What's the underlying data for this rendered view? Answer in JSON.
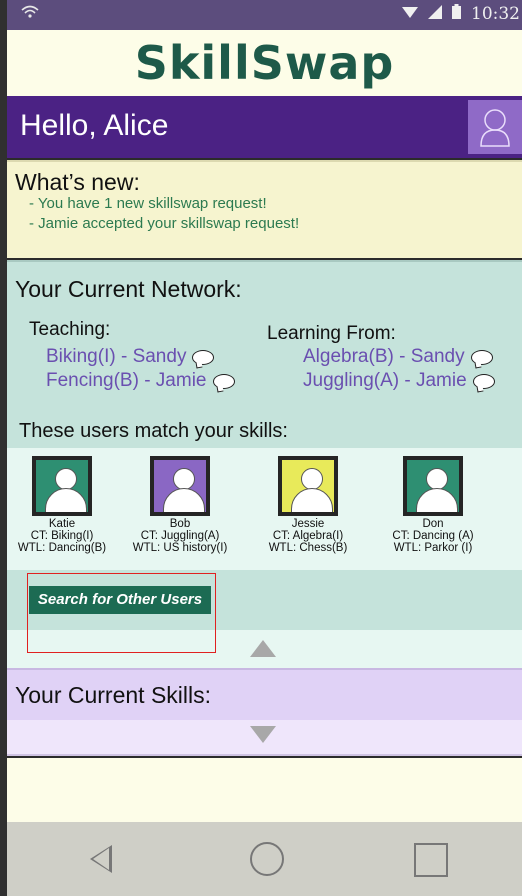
{
  "status_bar": {
    "time": "10:32",
    "icons": [
      "wifi-icon",
      "signal-icon",
      "battery-icon"
    ]
  },
  "app": {
    "logo": "SkillSwap",
    "greeting": "Hello, Alice"
  },
  "whats_new": {
    "title": "What’s new:",
    "items": [
      "- You have 1 new skillswap request!",
      "- Jamie accepted your skillswap request!"
    ]
  },
  "network": {
    "title": "Your Current Network:",
    "teaching_label": "Teaching:",
    "learning_label": "Learning From:",
    "teaching": [
      "Biking(I) - Sandy",
      "Fencing(B) - Jamie"
    ],
    "learning": [
      "Algebra(B) - Sandy",
      "Juggling(A) - Jamie"
    ]
  },
  "matches": {
    "title": "These users match your skills:",
    "users": [
      {
        "name": "Katie",
        "ct": "CT: Biking(I)",
        "wtl": "WTL: Dancing(B)",
        "color": "#2e8f72"
      },
      {
        "name": "Bob",
        "ct": "CT: Juggling(A)",
        "wtl": "WTL: US history(I)",
        "color": "#8a67c4"
      },
      {
        "name": "Jessie",
        "ct": "CT: Algebra(I)",
        "wtl": "WTL: Chess(B)",
        "color": "#e8ea5a"
      },
      {
        "name": "Don",
        "ct": "CT: Dancing (A)",
        "wtl": "WTL: Parkor (I)",
        "color": "#2e8f72"
      }
    ],
    "search_button": "Search for Other Users"
  },
  "skills": {
    "title": "Your Current Skills:"
  },
  "colors": {
    "header_purple": "#4b2284",
    "logo_green": "#1e5a49",
    "link_purple": "#6a4fb0",
    "news_green": "#2c7a50"
  }
}
